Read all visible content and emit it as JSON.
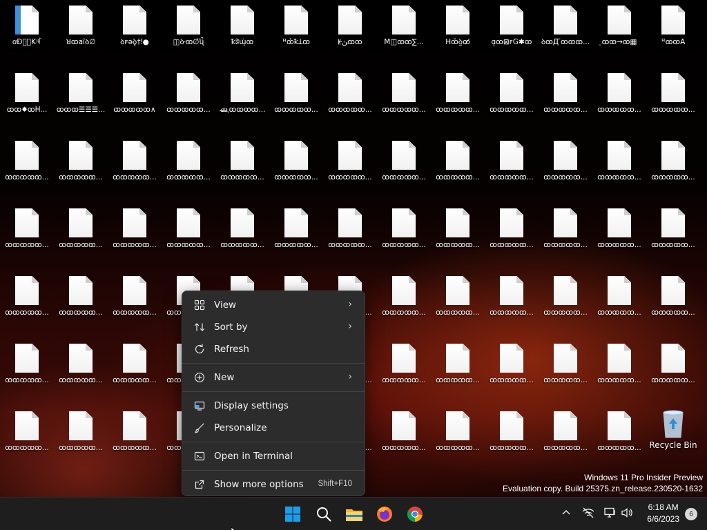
{
  "desktop": {
    "files": [
      {
        "label": "ꭤĐꁒ⃯Kꎭ",
        "blue": true
      },
      {
        "label": "ꓤꝏaĩꝺ∅"
      },
      {
        "label": "ꝺꜰəꝺ̥†ǃ●"
      },
      {
        "label": "◫ꝺ᠊ꝏ∅́ʯ́̆"
      },
      {
        "label": "ꝁʬ̈ɯ̨̈ꝏ"
      },
      {
        "label": "ꟸꝏ͑ꝁꓕꝏ⁠"
      },
      {
        "label": "ꡡڽꝏꝏ"
      },
      {
        "label": "M◫ꝏꝏ∑..."
      },
      {
        "label": "Hꝏ̃ꝺ̰ꝏ̸"
      },
      {
        "label": "ɑ̨ꝏ⊠ꜰG✱ꝏ"
      },
      {
        "label": "ꝺꝏꙢꝏꝏꝏ..."
      },
      {
        "label": "̩ꝏꝏ→ꝏ▦"
      },
      {
        "label": "ꟸꝏꝏA"
      },
      {
        "label": "ꝏꝏ✸ꝏH..."
      },
      {
        "label": "ꝏꝏꝏ☰☰☰..."
      },
      {
        "label": "ꝏꝏꝏꝏꝏ∧"
      },
      {
        "label": "ꝏꝏꝏꝏꝏ..."
      },
      {
        "label": "ⶺꝏꝏꝏꝏ..."
      },
      {
        "label": "ꝏꝏꝏꝏꝏ..."
      },
      {
        "label": "ꝏꝏꝏꝏꝏ..."
      },
      {
        "label": "ꝏꝏꝏꝏꝏ..."
      },
      {
        "label": "ꝏꝏꝏꝏꝏ..."
      },
      {
        "label": "ꝏꝏꝏꝏꝏ..."
      },
      {
        "label": "ꝏꝏꝏꝏꝏ..."
      },
      {
        "label": "ꝏꝏꝏꝏꝏ..."
      },
      {
        "label": "ꝏꝏꝏꝏꝏ..."
      },
      {
        "label": "ꝏꝏꝏꝏꝏ..."
      },
      {
        "label": "ꝏꝏꝏꝏꝏ..."
      },
      {
        "label": "ꝏꝏꝏꝏꝏ..."
      },
      {
        "label": "ꝏꝏꝏꝏꝏ..."
      },
      {
        "label": "ꝏꝏꝏꝏꝏ..."
      },
      {
        "label": "ꝏꝏꝏꝏꝏ..."
      },
      {
        "label": "ꝏꝏꝏꝏꝏ..."
      },
      {
        "label": "ꝏꝏꝏꝏꝏ..."
      },
      {
        "label": "ꝏꝏꝏꝏꝏ..."
      },
      {
        "label": "ꝏꝏꝏꝏꝏ..."
      },
      {
        "label": "ꝏꝏꝏꝏꝏ..."
      },
      {
        "label": "ꝏꝏꝏꝏꝏ..."
      },
      {
        "label": "ꝏꝏꝏꝏꝏ..."
      },
      {
        "label": "ꝏꝏꝏꝏꝏ..."
      },
      {
        "label": "ꝏꝏꝏꝏꝏ..."
      },
      {
        "label": "ꝏꝏꝏꝏꝏ..."
      },
      {
        "label": "ꝏꝏꝏꝏꝏ..."
      },
      {
        "label": "ꝏꝏꝏꝏꝏ..."
      },
      {
        "label": "ꝏꝏꝏꝏꝏ..."
      },
      {
        "label": "ꝏꝏꝏꝏꝏ..."
      },
      {
        "label": "ꝏꝏꝏꝏꝏ..."
      },
      {
        "label": "ꝏꝏꝏꝏꝏ..."
      },
      {
        "label": "ꝏꝏꝏꝏꝏ..."
      },
      {
        "label": "ꝏꝏꝏꝏꝏ..."
      },
      {
        "label": "ꝏꝏꝏꝏꝏ..."
      },
      {
        "label": "ꝏꝏꝏꝏꝏ..."
      },
      {
        "label": "ꝏꝏꝏꝏꝏ..."
      },
      {
        "label": "ꝏꝏꝏꝏꝏ..."
      },
      {
        "label": "ꝏꝏꝏꝏꝏ..."
      },
      {
        "label": "ꝏꝏꝏꝏꝏ..."
      },
      {
        "label": "ꝏꝏꝏꝏꝏ..."
      },
      {
        "label": "ꝏꝏꝏꝏꝏ..."
      },
      {
        "label": "ꝏꝏꝏꝏꝏ..."
      },
      {
        "label": "ꝏꝏꝏꝏꝏ..."
      },
      {
        "label": "ꝏꝏꝏꝏꝏ..."
      },
      {
        "label": "ꝏꝏꝏꝏꝏ..."
      },
      {
        "label": "ꝏꝏꝏꝏꝏ..."
      },
      {
        "label": "ꝏꝏꝏꝏꝏ..."
      },
      {
        "label": "ꝏꝏꝏꝏꝏ..."
      },
      {
        "label": "ꝏꝏꝏꝏꝏ..."
      },
      {
        "label": "ꝏꝏꝏꝏꝏ..."
      },
      {
        "label": "ꝏꝏꝏꝏꝏ..."
      },
      {
        "label": "ꝏꝏꝏꝏꝏ..."
      },
      {
        "label": "ꝏꝏꝏꝏꝏ..."
      },
      {
        "label": "ꝏꝏꝏꝏꝏ..."
      },
      {
        "label": "ꝏꝏꝏꝏꝏ..."
      },
      {
        "label": "ꝏꝏꝏꝏꝏ..."
      },
      {
        "label": "ꝏꝏꝏꝏꝏ..."
      },
      {
        "label": "ꝏꝏꝏꝏꝏ..."
      },
      {
        "label": "ꝏꝏꝏꝏꝏ..."
      },
      {
        "label": "ꝏꝏꝏꝏꝏ..."
      },
      {
        "label": "ꝏꝏꝏꝏꝏ..."
      },
      {
        "label": "ꝏꝏꝏꝏꝏ..."
      },
      {
        "label": "ꝏꝏꝏꝏꝏ..."
      },
      {
        "label": "ꝏꝏꝏꝏꝏ..."
      },
      {
        "label": "ꝏꝏꝏꝏꝏ..."
      },
      {
        "label": "ꝏꝏꝏꝏꝏ..."
      },
      {
        "label": "ꝏꝏꝏꝏꝏ..."
      },
      {
        "label": "ꝏꝏꝏꝏꝏ..."
      },
      {
        "label": "ꝏꝏꝏꝏꝏ..."
      },
      {
        "label": "ꝏꝏꝏꝏꝏ..."
      },
      {
        "label": "ꝏꝏꝏꝏꝏ..."
      },
      {
        "label": "ꝏꝏꝏꝏꝏ..."
      },
      {
        "label": "ꝏꝏꝏꝏꝏ..."
      }
    ],
    "recycle_bin_label": "Recycle Bin"
  },
  "context_menu": {
    "items": [
      {
        "label": "View",
        "icon": "grid-icon",
        "submenu": true
      },
      {
        "label": "Sort by",
        "icon": "sort-icon",
        "submenu": true
      },
      {
        "label": "Refresh",
        "icon": "refresh-icon"
      },
      {
        "label": "New",
        "icon": "plus-circle-icon",
        "submenu": true
      },
      {
        "label": "Display settings",
        "icon": "display-icon"
      },
      {
        "label": "Personalize",
        "icon": "brush-icon"
      },
      {
        "label": "Open in Terminal",
        "icon": "terminal-icon"
      },
      {
        "label": "Show more options",
        "icon": "external-icon",
        "shortcut": "Shift+F10"
      }
    ]
  },
  "watermark": {
    "line1": "Windows 11 Pro Insider Preview",
    "line2": "Evaluation copy. Build 25375.zn_release.230520-1632"
  },
  "taskbar": {
    "apps": [
      "start-icon",
      "search-icon",
      "file-explorer-icon",
      "firefox-icon",
      "chrome-icon"
    ],
    "clock_time": "6:18 AM",
    "clock_date": "6/6/2023",
    "notification_count": "6",
    "accent": "#0078d4"
  }
}
